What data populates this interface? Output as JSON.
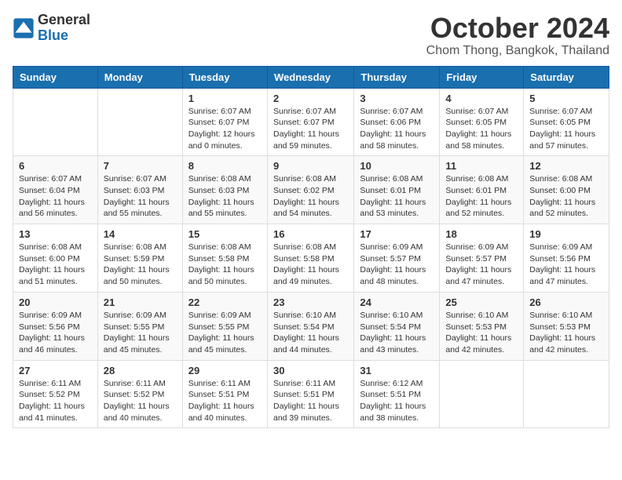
{
  "header": {
    "logo": {
      "general": "General",
      "blue": "Blue"
    },
    "title": "October 2024",
    "location": "Chom Thong, Bangkok, Thailand"
  },
  "calendar": {
    "headers": [
      "Sunday",
      "Monday",
      "Tuesday",
      "Wednesday",
      "Thursday",
      "Friday",
      "Saturday"
    ],
    "weeks": [
      [
        {
          "day": "",
          "info": ""
        },
        {
          "day": "",
          "info": ""
        },
        {
          "day": "1",
          "info": "Sunrise: 6:07 AM\nSunset: 6:07 PM\nDaylight: 12 hours\nand 0 minutes."
        },
        {
          "day": "2",
          "info": "Sunrise: 6:07 AM\nSunset: 6:07 PM\nDaylight: 11 hours\nand 59 minutes."
        },
        {
          "day": "3",
          "info": "Sunrise: 6:07 AM\nSunset: 6:06 PM\nDaylight: 11 hours\nand 58 minutes."
        },
        {
          "day": "4",
          "info": "Sunrise: 6:07 AM\nSunset: 6:05 PM\nDaylight: 11 hours\nand 58 minutes."
        },
        {
          "day": "5",
          "info": "Sunrise: 6:07 AM\nSunset: 6:05 PM\nDaylight: 11 hours\nand 57 minutes."
        }
      ],
      [
        {
          "day": "6",
          "info": "Sunrise: 6:07 AM\nSunset: 6:04 PM\nDaylight: 11 hours\nand 56 minutes."
        },
        {
          "day": "7",
          "info": "Sunrise: 6:07 AM\nSunset: 6:03 PM\nDaylight: 11 hours\nand 55 minutes."
        },
        {
          "day": "8",
          "info": "Sunrise: 6:08 AM\nSunset: 6:03 PM\nDaylight: 11 hours\nand 55 minutes."
        },
        {
          "day": "9",
          "info": "Sunrise: 6:08 AM\nSunset: 6:02 PM\nDaylight: 11 hours\nand 54 minutes."
        },
        {
          "day": "10",
          "info": "Sunrise: 6:08 AM\nSunset: 6:01 PM\nDaylight: 11 hours\nand 53 minutes."
        },
        {
          "day": "11",
          "info": "Sunrise: 6:08 AM\nSunset: 6:01 PM\nDaylight: 11 hours\nand 52 minutes."
        },
        {
          "day": "12",
          "info": "Sunrise: 6:08 AM\nSunset: 6:00 PM\nDaylight: 11 hours\nand 52 minutes."
        }
      ],
      [
        {
          "day": "13",
          "info": "Sunrise: 6:08 AM\nSunset: 6:00 PM\nDaylight: 11 hours\nand 51 minutes."
        },
        {
          "day": "14",
          "info": "Sunrise: 6:08 AM\nSunset: 5:59 PM\nDaylight: 11 hours\nand 50 minutes."
        },
        {
          "day": "15",
          "info": "Sunrise: 6:08 AM\nSunset: 5:58 PM\nDaylight: 11 hours\nand 50 minutes."
        },
        {
          "day": "16",
          "info": "Sunrise: 6:08 AM\nSunset: 5:58 PM\nDaylight: 11 hours\nand 49 minutes."
        },
        {
          "day": "17",
          "info": "Sunrise: 6:09 AM\nSunset: 5:57 PM\nDaylight: 11 hours\nand 48 minutes."
        },
        {
          "day": "18",
          "info": "Sunrise: 6:09 AM\nSunset: 5:57 PM\nDaylight: 11 hours\nand 47 minutes."
        },
        {
          "day": "19",
          "info": "Sunrise: 6:09 AM\nSunset: 5:56 PM\nDaylight: 11 hours\nand 47 minutes."
        }
      ],
      [
        {
          "day": "20",
          "info": "Sunrise: 6:09 AM\nSunset: 5:56 PM\nDaylight: 11 hours\nand 46 minutes."
        },
        {
          "day": "21",
          "info": "Sunrise: 6:09 AM\nSunset: 5:55 PM\nDaylight: 11 hours\nand 45 minutes."
        },
        {
          "day": "22",
          "info": "Sunrise: 6:09 AM\nSunset: 5:55 PM\nDaylight: 11 hours\nand 45 minutes."
        },
        {
          "day": "23",
          "info": "Sunrise: 6:10 AM\nSunset: 5:54 PM\nDaylight: 11 hours\nand 44 minutes."
        },
        {
          "day": "24",
          "info": "Sunrise: 6:10 AM\nSunset: 5:54 PM\nDaylight: 11 hours\nand 43 minutes."
        },
        {
          "day": "25",
          "info": "Sunrise: 6:10 AM\nSunset: 5:53 PM\nDaylight: 11 hours\nand 42 minutes."
        },
        {
          "day": "26",
          "info": "Sunrise: 6:10 AM\nSunset: 5:53 PM\nDaylight: 11 hours\nand 42 minutes."
        }
      ],
      [
        {
          "day": "27",
          "info": "Sunrise: 6:11 AM\nSunset: 5:52 PM\nDaylight: 11 hours\nand 41 minutes."
        },
        {
          "day": "28",
          "info": "Sunrise: 6:11 AM\nSunset: 5:52 PM\nDaylight: 11 hours\nand 40 minutes."
        },
        {
          "day": "29",
          "info": "Sunrise: 6:11 AM\nSunset: 5:51 PM\nDaylight: 11 hours\nand 40 minutes."
        },
        {
          "day": "30",
          "info": "Sunrise: 6:11 AM\nSunset: 5:51 PM\nDaylight: 11 hours\nand 39 minutes."
        },
        {
          "day": "31",
          "info": "Sunrise: 6:12 AM\nSunset: 5:51 PM\nDaylight: 11 hours\nand 38 minutes."
        },
        {
          "day": "",
          "info": ""
        },
        {
          "day": "",
          "info": ""
        }
      ]
    ]
  }
}
